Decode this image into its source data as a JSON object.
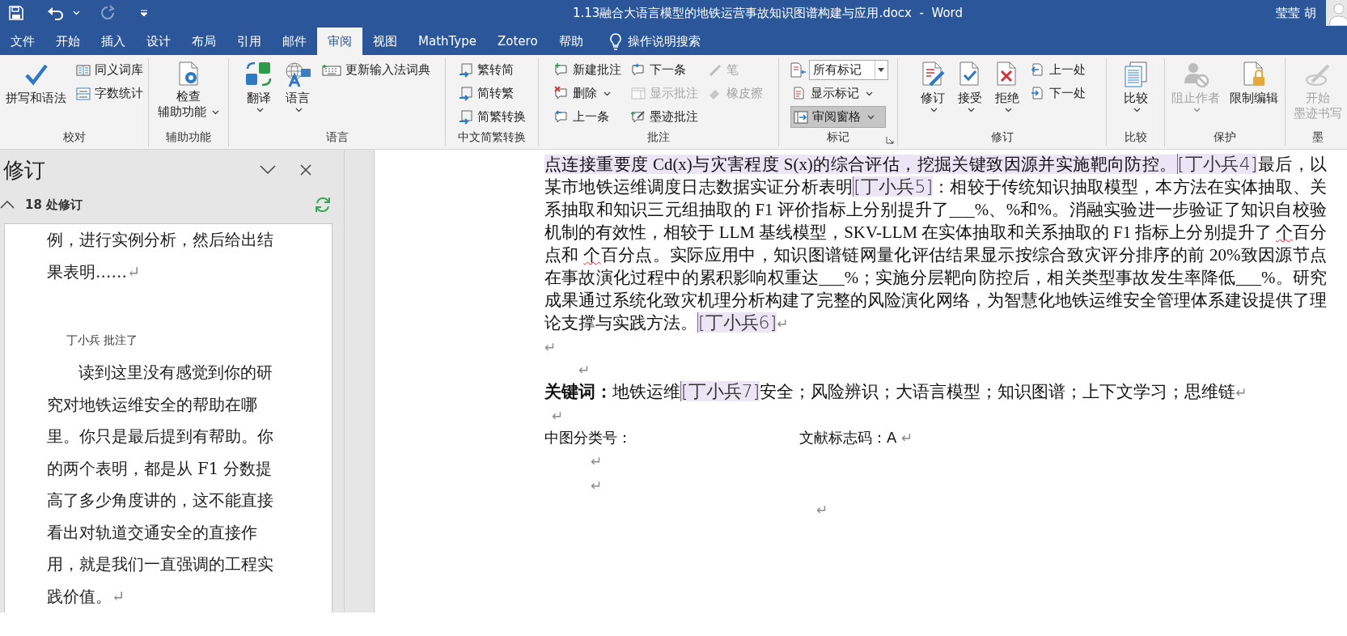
{
  "title_bar": {
    "title": "1.13融合大语言模型的地铁运营事故知识图谱构建与应用.docx  -  Word",
    "user": "莹莹 胡"
  },
  "tabs": [
    {
      "label": "文件",
      "selected": false
    },
    {
      "label": "开始",
      "selected": false
    },
    {
      "label": "插入",
      "selected": false
    },
    {
      "label": "设计",
      "selected": false
    },
    {
      "label": "布局",
      "selected": false
    },
    {
      "label": "引用",
      "selected": false
    },
    {
      "label": "邮件",
      "selected": false
    },
    {
      "label": "审阅",
      "selected": true
    },
    {
      "label": "视图",
      "selected": false
    },
    {
      "label": "MathType",
      "selected": false
    },
    {
      "label": "Zotero",
      "selected": false
    },
    {
      "label": "帮助",
      "selected": false
    }
  ],
  "tell_me": {
    "placeholder": "操作说明搜索"
  },
  "ribbon": {
    "groups": [
      {
        "label": "校对",
        "launcher": false,
        "columns": [
          {
            "kind": "large",
            "items": [
              {
                "kind": "button",
                "lines": [
                  "拼写和语法"
                ],
                "caret": false,
                "disabled": false
              }
            ]
          },
          {
            "kind": "stack",
            "items": [
              {
                "kind": "button",
                "lines": [
                  "同义词库"
                ],
                "caret": false,
                "disabled": false
              },
              {
                "kind": "button",
                "lines": [
                  "字数统计"
                ],
                "caret": false,
                "disabled": false
              }
            ]
          }
        ]
      },
      {
        "label": "辅助功能",
        "launcher": false,
        "columns": [
          {
            "kind": "large",
            "items": [
              {
                "kind": "button",
                "lines": [
                  "检查",
                  "辅助功能"
                ],
                "caret": true,
                "disabled": false
              }
            ]
          }
        ]
      },
      {
        "label": "语言",
        "launcher": false,
        "columns": [
          {
            "kind": "large",
            "items": [
              {
                "kind": "button",
                "lines": [
                  "翻译"
                ],
                "caret": true,
                "disabled": false
              }
            ]
          },
          {
            "kind": "large",
            "items": [
              {
                "kind": "button",
                "lines": [
                  "语言"
                ],
                "caret": true,
                "disabled": false
              }
            ]
          },
          {
            "kind": "stack",
            "items": [
              {
                "kind": "button",
                "lines": [
                  "更新输入法词典"
                ],
                "caret": false,
                "disabled": false
              }
            ]
          }
        ]
      },
      {
        "label": "中文简繁转换",
        "launcher": false,
        "columns": [
          {
            "kind": "stack",
            "items": [
              {
                "kind": "button",
                "lines": [
                  "繁转简"
                ],
                "caret": false,
                "disabled": false
              },
              {
                "kind": "button",
                "lines": [
                  "简转繁"
                ],
                "caret": false,
                "disabled": false
              },
              {
                "kind": "button",
                "lines": [
                  "简繁转换"
                ],
                "caret": false,
                "disabled": false
              }
            ]
          }
        ]
      },
      {
        "label": "批注",
        "launcher": false,
        "columns": [
          {
            "kind": "stack",
            "items": [
              {
                "kind": "button",
                "lines": [
                  "新建批注"
                ],
                "caret": false,
                "disabled": false
              },
              {
                "kind": "button",
                "lines": [
                  "删除"
                ],
                "caret": true,
                "disabled": false
              },
              {
                "kind": "button",
                "lines": [
                  "上一条"
                ],
                "caret": false,
                "disabled": false
              }
            ]
          },
          {
            "kind": "stack",
            "items": [
              {
                "kind": "button",
                "lines": [
                  "下一条"
                ],
                "caret": false,
                "disabled": false
              },
              {
                "kind": "button",
                "lines": [
                  "显示批注"
                ],
                "caret": false,
                "disabled": true
              },
              {
                "kind": "button",
                "lines": [
                  "墨迹批注"
                ],
                "caret": false,
                "disabled": false
              }
            ]
          },
          {
            "kind": "stack",
            "items": [
              {
                "kind": "button",
                "lines": [
                  "笔"
                ],
                "caret": false,
                "disabled": true
              },
              {
                "kind": "button",
                "lines": [
                  "橡皮擦"
                ],
                "caret": false,
                "disabled": true
              }
            ]
          }
        ]
      },
      {
        "label": "标记",
        "launcher": true,
        "columns": [
          {
            "kind": "stack",
            "items": [
              {
                "kind": "combo",
                "lines": [
                  "所有标记"
                ],
                "caret": true,
                "disabled": false,
                "pressed": false
              },
              {
                "kind": "button",
                "lines": [
                  "显示标记"
                ],
                "caret": true,
                "disabled": false,
                "pressed": false
              },
              {
                "kind": "button",
                "lines": [
                  "审阅窗格"
                ],
                "caret": true,
                "disabled": false,
                "pressed": true
              }
            ]
          }
        ]
      },
      {
        "label": "修订",
        "launcher": false,
        "columns": [
          {
            "kind": "large",
            "items": [
              {
                "kind": "button",
                "lines": [
                  "修订"
                ],
                "caret": true,
                "disabled": false
              }
            ]
          },
          {
            "kind": "large",
            "items": [
              {
                "kind": "button",
                "lines": [
                  "接受"
                ],
                "caret": true,
                "disabled": false
              }
            ]
          },
          {
            "kind": "large",
            "items": [
              {
                "kind": "button",
                "lines": [
                  "拒绝"
                ],
                "caret": true,
                "disabled": false
              }
            ]
          },
          {
            "kind": "stack",
            "items": [
              {
                "kind": "button",
                "lines": [
                  "上一处"
                ],
                "caret": false,
                "disabled": false
              },
              {
                "kind": "button",
                "lines": [
                  "下一处"
                ],
                "caret": false,
                "disabled": false
              }
            ]
          }
        ]
      },
      {
        "label": "比较",
        "launcher": false,
        "columns": [
          {
            "kind": "large",
            "items": [
              {
                "kind": "button",
                "lines": [
                  "比较"
                ],
                "caret": true,
                "disabled": false
              }
            ]
          }
        ]
      },
      {
        "label": "保护",
        "launcher": false,
        "columns": [
          {
            "kind": "large",
            "items": [
              {
                "kind": "button",
                "lines": [
                  "阻止作者"
                ],
                "caret": true,
                "disabled": true
              }
            ]
          },
          {
            "kind": "large",
            "items": [
              {
                "kind": "button",
                "lines": [
                  "限制编辑"
                ],
                "caret": false,
                "disabled": false
              }
            ]
          }
        ]
      },
      {
        "label": "墨",
        "launcher": false,
        "columns": [
          {
            "kind": "large",
            "items": [
              {
                "kind": "button",
                "lines": [
                  "开始",
                  "墨迹书写"
                ],
                "caret": false,
                "disabled": true
              }
            ]
          }
        ]
      }
    ]
  },
  "review_pane": {
    "title": "修订",
    "summary": "18 处修订",
    "expanded": true,
    "entries": [
      {
        "kind": "text",
        "text": "例，进行实例分析，然后给出结果表明……",
        "mark": "↵"
      },
      {
        "kind": "author",
        "text": "丁小兵 批注了"
      },
      {
        "kind": "comment",
        "text": "读到这里没有感觉到你的研究对地铁运维安全的帮助在哪里。你只是最后提到有帮助。你的两个表明，都是从 F1 分数提高了多少角度讲的，这不能直接看出对轨道交通安全的直接作用，就是我们一直强调的工程实践价值。",
        "mark": "↵"
      }
    ]
  },
  "document": {
    "blocks": [
      {
        "kind": "paragraph",
        "mark": "↵",
        "segments": [
          {
            "kind": "highlight",
            "text": "点连接重要度 Cd(x)与灾害程度 S(x)的综合评估，挖掘关键致因源并实施靶向防控。"
          },
          {
            "kind": "marker",
            "text": "[丁小兵4]"
          },
          {
            "kind": "text",
            "text": "最后，以某市地铁运维调度日志数据实证分析表明"
          },
          {
            "kind": "marker",
            "text": "[丁小兵5]"
          },
          {
            "kind": "text",
            "text": "：相较于传统知识抽取模型，本方法在实体抽取、关系抽取和知识三元组抽取的 F1 评价指标上分别提升了___%、%和%。消融实验进一步验证了知识自校验机制的有效性，相较于 LLM 基线模型，SKV-LLM 在实体抽取和关系抽取的 F1 指标上分别提升了 "
          },
          {
            "kind": "misspelled",
            "text": "个"
          },
          {
            "kind": "text",
            "text": "百分点和 "
          },
          {
            "kind": "misspelled",
            "text": "个"
          },
          {
            "kind": "text",
            "text": "百分点。实际应用中，知识图谱链网量化评估结果显示按综合致灾评分排序的前 20%致因源节点在事故演化过程中的累积影响权重达___%；实施分层靶向防控后，相关类型事故发生率降低___%。研究成果通过系统化致灾机理分析构建了完整的风险演化网络，为智慧化地铁运维安全管理体系建设提供了理论支撑与实践方法。"
          },
          {
            "kind": "marker",
            "text": "[丁小兵6]"
          }
        ]
      },
      {
        "kind": "empty",
        "mark": "↵"
      },
      {
        "kind": "empty_indent",
        "mark": "↵"
      },
      {
        "kind": "paragraph",
        "mark": "↵",
        "segments": [
          {
            "kind": "bold",
            "text": "关键词："
          },
          {
            "kind": "text",
            "text": "地铁运维"
          },
          {
            "kind": "marker",
            "text": "[丁小兵7]"
          },
          {
            "kind": "text",
            "text": "安全；风险辨识；大语言模型；知识图谱；上下文学习；思维链"
          }
        ]
      },
      {
        "kind": "empty_small",
        "mark": "↵"
      },
      {
        "kind": "classification",
        "left": "中图分类号：",
        "right": "文献标志码：A",
        "mark": "↵"
      },
      {
        "kind": "empty_wide",
        "mark": "↵"
      },
      {
        "kind": "empty_wide",
        "mark": "↵"
      },
      {
        "kind": "empty_far",
        "mark": "↵"
      }
    ]
  }
}
